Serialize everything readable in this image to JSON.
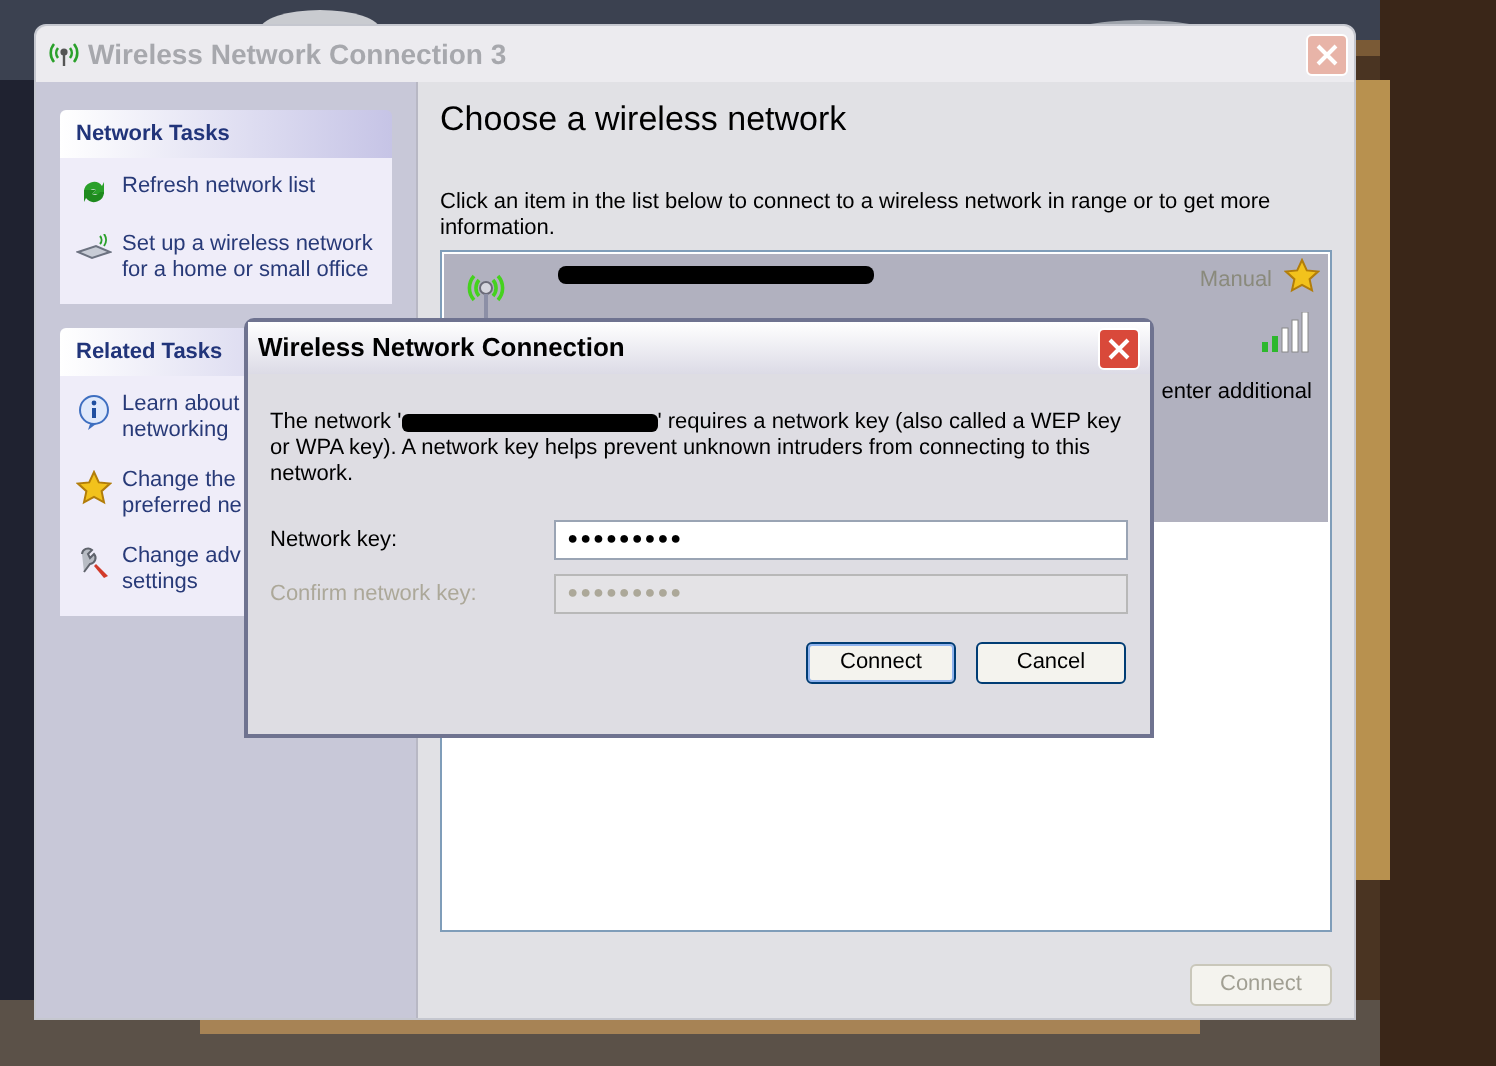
{
  "window": {
    "title": "Wireless Network Connection 3",
    "active": false
  },
  "sidebar": {
    "sections": [
      {
        "title": "Network Tasks",
        "items": [
          {
            "kind": "refresh",
            "label": "Refresh network list"
          },
          {
            "kind": "setup",
            "label": "Set up a wireless network\nfor a home or small office"
          }
        ]
      },
      {
        "title": "Related Tasks",
        "items": [
          {
            "kind": "info",
            "label": "Learn about\nnetworking"
          },
          {
            "kind": "star",
            "label": "Change the\npreferred ne"
          },
          {
            "kind": "tools",
            "label": "Change adv\nsettings"
          }
        ]
      }
    ]
  },
  "main": {
    "heading": "Choose a wireless network",
    "instructions": "Click an item in the list below to connect to a wireless network in range or to get more information.",
    "networks": [
      {
        "selected": true,
        "security": "Manual",
        "description": "enter additional"
      }
    ],
    "connect_button": {
      "label": "Connect",
      "disabled": true
    }
  },
  "dialog": {
    "title": "Wireless Network Connection",
    "message_before": "The network '",
    "message_after": "' requires a network key (also called a WEP key or WPA key). A network key helps prevent unknown intruders from connecting to this network.",
    "fields": [
      {
        "label": "Network key:",
        "value": "●●●●●●●●●",
        "disabled": false
      },
      {
        "label": "Confirm network key:",
        "value": "●●●●●●●●●",
        "disabled": true
      }
    ],
    "buttons": [
      {
        "label": "Connect",
        "default": true
      },
      {
        "label": "Cancel",
        "default": false
      }
    ]
  }
}
